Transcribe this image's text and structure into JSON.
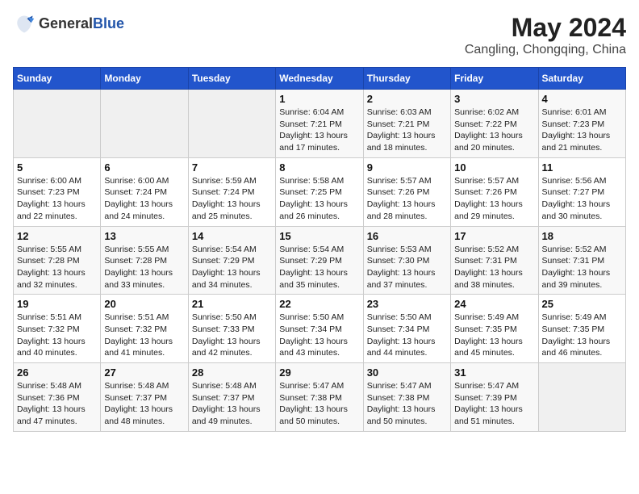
{
  "header": {
    "logo_general": "General",
    "logo_blue": "Blue",
    "month_year": "May 2024",
    "location": "Cangling, Chongqing, China"
  },
  "weekdays": [
    "Sunday",
    "Monday",
    "Tuesday",
    "Wednesday",
    "Thursday",
    "Friday",
    "Saturday"
  ],
  "weeks": [
    [
      {
        "day": "",
        "info": ""
      },
      {
        "day": "",
        "info": ""
      },
      {
        "day": "",
        "info": ""
      },
      {
        "day": "1",
        "info": "Sunrise: 6:04 AM\nSunset: 7:21 PM\nDaylight: 13 hours\nand 17 minutes."
      },
      {
        "day": "2",
        "info": "Sunrise: 6:03 AM\nSunset: 7:21 PM\nDaylight: 13 hours\nand 18 minutes."
      },
      {
        "day": "3",
        "info": "Sunrise: 6:02 AM\nSunset: 7:22 PM\nDaylight: 13 hours\nand 20 minutes."
      },
      {
        "day": "4",
        "info": "Sunrise: 6:01 AM\nSunset: 7:23 PM\nDaylight: 13 hours\nand 21 minutes."
      }
    ],
    [
      {
        "day": "5",
        "info": "Sunrise: 6:00 AM\nSunset: 7:23 PM\nDaylight: 13 hours\nand 22 minutes."
      },
      {
        "day": "6",
        "info": "Sunrise: 6:00 AM\nSunset: 7:24 PM\nDaylight: 13 hours\nand 24 minutes."
      },
      {
        "day": "7",
        "info": "Sunrise: 5:59 AM\nSunset: 7:24 PM\nDaylight: 13 hours\nand 25 minutes."
      },
      {
        "day": "8",
        "info": "Sunrise: 5:58 AM\nSunset: 7:25 PM\nDaylight: 13 hours\nand 26 minutes."
      },
      {
        "day": "9",
        "info": "Sunrise: 5:57 AM\nSunset: 7:26 PM\nDaylight: 13 hours\nand 28 minutes."
      },
      {
        "day": "10",
        "info": "Sunrise: 5:57 AM\nSunset: 7:26 PM\nDaylight: 13 hours\nand 29 minutes."
      },
      {
        "day": "11",
        "info": "Sunrise: 5:56 AM\nSunset: 7:27 PM\nDaylight: 13 hours\nand 30 minutes."
      }
    ],
    [
      {
        "day": "12",
        "info": "Sunrise: 5:55 AM\nSunset: 7:28 PM\nDaylight: 13 hours\nand 32 minutes."
      },
      {
        "day": "13",
        "info": "Sunrise: 5:55 AM\nSunset: 7:28 PM\nDaylight: 13 hours\nand 33 minutes."
      },
      {
        "day": "14",
        "info": "Sunrise: 5:54 AM\nSunset: 7:29 PM\nDaylight: 13 hours\nand 34 minutes."
      },
      {
        "day": "15",
        "info": "Sunrise: 5:54 AM\nSunset: 7:29 PM\nDaylight: 13 hours\nand 35 minutes."
      },
      {
        "day": "16",
        "info": "Sunrise: 5:53 AM\nSunset: 7:30 PM\nDaylight: 13 hours\nand 37 minutes."
      },
      {
        "day": "17",
        "info": "Sunrise: 5:52 AM\nSunset: 7:31 PM\nDaylight: 13 hours\nand 38 minutes."
      },
      {
        "day": "18",
        "info": "Sunrise: 5:52 AM\nSunset: 7:31 PM\nDaylight: 13 hours\nand 39 minutes."
      }
    ],
    [
      {
        "day": "19",
        "info": "Sunrise: 5:51 AM\nSunset: 7:32 PM\nDaylight: 13 hours\nand 40 minutes."
      },
      {
        "day": "20",
        "info": "Sunrise: 5:51 AM\nSunset: 7:32 PM\nDaylight: 13 hours\nand 41 minutes."
      },
      {
        "day": "21",
        "info": "Sunrise: 5:50 AM\nSunset: 7:33 PM\nDaylight: 13 hours\nand 42 minutes."
      },
      {
        "day": "22",
        "info": "Sunrise: 5:50 AM\nSunset: 7:34 PM\nDaylight: 13 hours\nand 43 minutes."
      },
      {
        "day": "23",
        "info": "Sunrise: 5:50 AM\nSunset: 7:34 PM\nDaylight: 13 hours\nand 44 minutes."
      },
      {
        "day": "24",
        "info": "Sunrise: 5:49 AM\nSunset: 7:35 PM\nDaylight: 13 hours\nand 45 minutes."
      },
      {
        "day": "25",
        "info": "Sunrise: 5:49 AM\nSunset: 7:35 PM\nDaylight: 13 hours\nand 46 minutes."
      }
    ],
    [
      {
        "day": "26",
        "info": "Sunrise: 5:48 AM\nSunset: 7:36 PM\nDaylight: 13 hours\nand 47 minutes."
      },
      {
        "day": "27",
        "info": "Sunrise: 5:48 AM\nSunset: 7:37 PM\nDaylight: 13 hours\nand 48 minutes."
      },
      {
        "day": "28",
        "info": "Sunrise: 5:48 AM\nSunset: 7:37 PM\nDaylight: 13 hours\nand 49 minutes."
      },
      {
        "day": "29",
        "info": "Sunrise: 5:47 AM\nSunset: 7:38 PM\nDaylight: 13 hours\nand 50 minutes."
      },
      {
        "day": "30",
        "info": "Sunrise: 5:47 AM\nSunset: 7:38 PM\nDaylight: 13 hours\nand 50 minutes."
      },
      {
        "day": "31",
        "info": "Sunrise: 5:47 AM\nSunset: 7:39 PM\nDaylight: 13 hours\nand 51 minutes."
      },
      {
        "day": "",
        "info": ""
      }
    ]
  ]
}
